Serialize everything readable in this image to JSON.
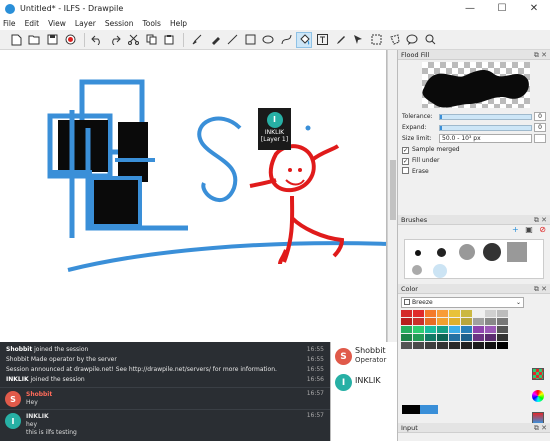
{
  "window": {
    "title": "Untitled* - ILFS - Drawpile",
    "minimize": "—",
    "maximize": "☐",
    "close": "✕"
  },
  "menu": [
    "File",
    "Edit",
    "View",
    "Layer",
    "Session",
    "Tools",
    "Help"
  ],
  "canvas": {
    "tooltip_name": "INKLIK",
    "tooltip_layer": "[Layer 1]",
    "tooltip_avatar": "I"
  },
  "chat": {
    "lines": [
      {
        "user": "Shobbit",
        "text": " joined the session",
        "time": "16:55"
      },
      {
        "user": "",
        "text": "Shobbit Made operator by the server",
        "time": "16:55"
      },
      {
        "user": "",
        "text": "Session announced at drawpile.net! See http://drawpile.net/servers/ for more information.",
        "time": "16:55"
      },
      {
        "user": "INKLIK",
        "text": " joined the session",
        "time": "16:56"
      }
    ],
    "messages": [
      {
        "avatar": "S",
        "name": "Shobbit",
        "lines": [
          "Hey"
        ],
        "time": "16:57"
      },
      {
        "avatar": "I",
        "name": "INKLIK",
        "lines": [
          "hey",
          "this is ilfs testing"
        ],
        "time": "16:57"
      }
    ]
  },
  "users": [
    {
      "avatar": "S",
      "name": "Shobbit",
      "role": "Operator"
    },
    {
      "avatar": "I",
      "name": "INKLIK",
      "role": ""
    }
  ],
  "dock": {
    "flood_fill": {
      "header": "Flood Fill",
      "tolerance_label": "Tolerance:",
      "tolerance_value": "0",
      "expand_label": "Expand:",
      "expand_value": "0",
      "size_limit_label": "Size limit:",
      "size_limit_value": "50.0 - 10³ px",
      "sample_merged": "Sample merged",
      "fill_under": "Fill under",
      "erase": "Erase"
    },
    "brushes": {
      "header": "Brushes"
    },
    "color": {
      "header": "Color",
      "palette": "Breeze"
    },
    "input": {
      "header": "Input"
    }
  },
  "colors": {
    "accent": "#3a8fd8",
    "chat_bg": "#2a2e33",
    "avatar_s": "#e05a4a",
    "avatar_i": "#27b0a5"
  }
}
